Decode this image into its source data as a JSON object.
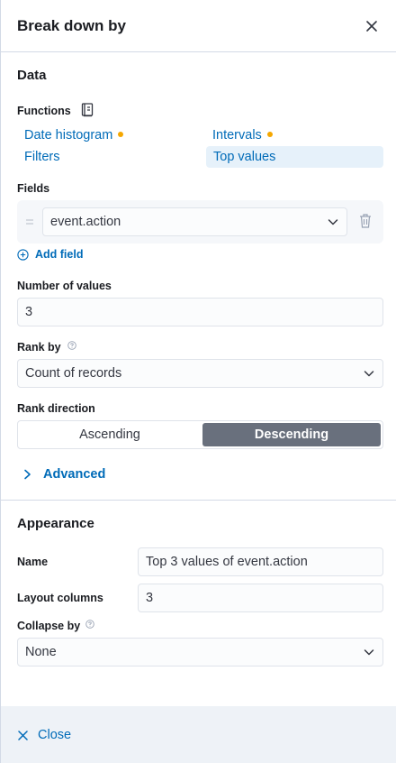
{
  "header": {
    "title": "Break down by",
    "close_icon": "close-icon"
  },
  "data_section": {
    "title": "Data",
    "functions": {
      "label": "Functions",
      "help_icon": "documentation-icon",
      "items": [
        {
          "label": "Date histogram",
          "has_warning_dot": true,
          "selected": false
        },
        {
          "label": "Intervals",
          "has_warning_dot": true,
          "selected": false
        },
        {
          "label": "Filters",
          "has_warning_dot": false,
          "selected": false
        },
        {
          "label": "Top values",
          "has_warning_dot": false,
          "selected": true
        }
      ]
    },
    "fields": {
      "label": "Fields",
      "selected_field": "event.action",
      "add_field_label": "Add field"
    },
    "number_of_values": {
      "label": "Number of values",
      "value": "3"
    },
    "rank_by": {
      "label": "Rank by",
      "value": "Count of records"
    },
    "rank_direction": {
      "label": "Rank direction",
      "options": [
        "Ascending",
        "Descending"
      ],
      "selected": "Descending"
    },
    "advanced_label": "Advanced"
  },
  "appearance_section": {
    "title": "Appearance",
    "name": {
      "label": "Name",
      "value": "Top 3 values of event.action"
    },
    "layout_columns": {
      "label": "Layout columns",
      "value": "3"
    },
    "collapse_by": {
      "label": "Collapse by",
      "value": "None"
    }
  },
  "footer": {
    "close_label": "Close"
  },
  "colors": {
    "link": "#006bb8",
    "warning_dot": "#f5a700",
    "selected_bg": "#e6f1fa",
    "toggle_selected_bg": "#69707d",
    "footer_bg": "#eef2f7"
  }
}
